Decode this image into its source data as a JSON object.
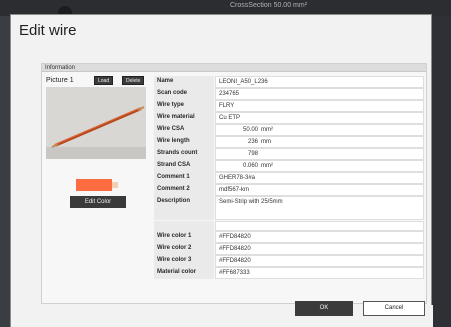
{
  "background": {
    "cross_section_text": "CrossSection   50.00 mm²"
  },
  "dialog": {
    "title": "Edit wire",
    "group_label": "Information",
    "picture": {
      "label": "Picture 1",
      "load_label": "Load",
      "delete_label": "Delete"
    },
    "swatch": {
      "main_color": "#FD6B40",
      "tip_color": "#F5D0B0"
    },
    "edit_color_label": "Edit Color",
    "properties": [
      {
        "name": "Name",
        "value": "LEONI_A50_L236"
      },
      {
        "name": "Scan code",
        "value": "234765"
      },
      {
        "name": "Wire type",
        "value": "FLRY"
      },
      {
        "name": "Wire material",
        "value": "Cu ETP"
      },
      {
        "name": "Wire CSA",
        "value": "50.00",
        "unit": "mm²"
      },
      {
        "name": "Wire length",
        "value": "236",
        "unit": "mm"
      },
      {
        "name": "Strands count",
        "value": "798"
      },
      {
        "name": "Strand CSA",
        "value": "0.060",
        "unit": "mm²"
      },
      {
        "name": "Comment 1",
        "value": "GHER78-3#a"
      },
      {
        "name": "Comment 2",
        "value": "mdf567-km"
      },
      {
        "name": "Description",
        "value": "Semi-Strip with 25/5mm"
      },
      {
        "name": "Wire color 1",
        "value": "#FFD84820"
      },
      {
        "name": "Wire color 2",
        "value": "#FFD84820"
      },
      {
        "name": "Wire color 3",
        "value": "#FFD84820"
      },
      {
        "name": "Material color",
        "value": "#FF687333"
      }
    ],
    "ok_label": "OK",
    "cancel_label": "Cancel"
  }
}
